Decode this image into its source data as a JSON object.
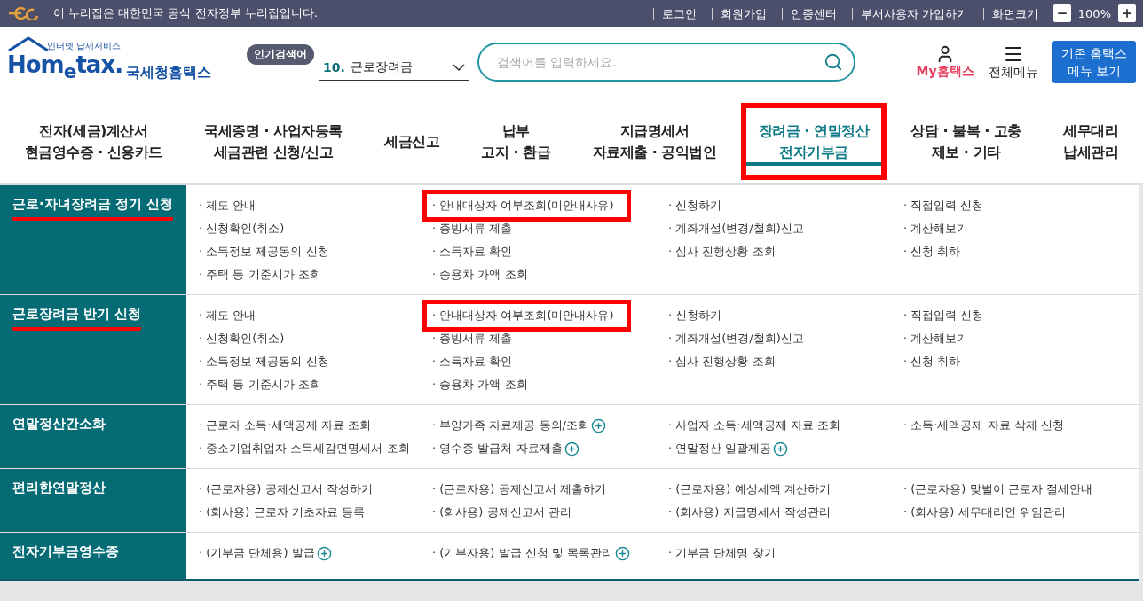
{
  "top_bar": {
    "notice": "이 누리집은 대한민국 공식 전자정부 누리집입니다.",
    "links": [
      "로그인",
      "회원가입",
      "인증센터",
      "부서사용자 가입하기"
    ],
    "zoom_label": "화면크기",
    "zoom_value": "100%"
  },
  "header": {
    "logo": {
      "tagline": "인터넷 납세서비스",
      "wordmark": "Hom$_{e}$tax.",
      "name": "국세청홈택스"
    },
    "popular": {
      "badge": "인기검색어",
      "rank": "10.",
      "term": "근로장려금"
    },
    "search": {
      "placeholder": "검색어를 입력하세요."
    },
    "my_label": "My홈택스",
    "menu_label": "전체메뉴",
    "legacy_button": "기존 홈택스\n메뉴 보기"
  },
  "nav_tabs": [
    {
      "label": "전자(세금)계산서\n현금영수증 · 신용카드",
      "selected": false,
      "boxed": false
    },
    {
      "label": "국세증명 · 사업자등록\n세금관련 신청/신고",
      "selected": false,
      "boxed": false
    },
    {
      "label": "세금신고",
      "selected": false,
      "boxed": false
    },
    {
      "label": "납부\n고지 · 환급",
      "selected": false,
      "boxed": false
    },
    {
      "label": "지급명세서\n자료제출 · 공익법인",
      "selected": false,
      "boxed": false
    },
    {
      "label": "장려금 · 연말정산\n전자기부금",
      "selected": true,
      "boxed": true
    },
    {
      "label": "상담 · 불복 · 고충\n제보 · 기타",
      "selected": false,
      "boxed": false
    },
    {
      "label": "세무대리\n납세관리",
      "selected": false,
      "boxed": false
    }
  ],
  "sections": [
    {
      "title": "근로·자녀장려금 정기 신청",
      "underlined": true,
      "columns": [
        [
          {
            "text": "· 제도 안내",
            "plus": false,
            "boxed": false
          },
          {
            "text": "· 신청확인(취소)",
            "plus": false,
            "boxed": false
          },
          {
            "text": "· 소득정보 제공동의 신청",
            "plus": false,
            "boxed": false
          },
          {
            "text": "· 주택 등 기준시가 조회",
            "plus": false,
            "boxed": false
          }
        ],
        [
          {
            "text": "· 안내대상자 여부조회(미안내사유)",
            "plus": false,
            "boxed": true
          },
          {
            "text": "· 증빙서류 제출",
            "plus": false,
            "boxed": false
          },
          {
            "text": "· 소득자료 확인",
            "plus": false,
            "boxed": false
          },
          {
            "text": "· 승용차 가액 조회",
            "plus": false,
            "boxed": false
          }
        ],
        [
          {
            "text": "· 신청하기",
            "plus": false,
            "boxed": false
          },
          {
            "text": "· 계좌개설(변경/철회)신고",
            "plus": false,
            "boxed": false
          },
          {
            "text": "· 심사 진행상황 조회",
            "plus": false,
            "boxed": false
          }
        ],
        [
          {
            "text": "· 직접입력 신청",
            "plus": false,
            "boxed": false
          },
          {
            "text": "· 계산해보기",
            "plus": false,
            "boxed": false
          },
          {
            "text": "· 신청 취하",
            "plus": false,
            "boxed": false
          }
        ]
      ]
    },
    {
      "title": "근로장려금 반기 신청",
      "underlined": true,
      "columns": [
        [
          {
            "text": "· 제도 안내",
            "plus": false,
            "boxed": false
          },
          {
            "text": "· 신청확인(취소)",
            "plus": false,
            "boxed": false
          },
          {
            "text": "· 소득정보 제공동의 신청",
            "plus": false,
            "boxed": false
          },
          {
            "text": "· 주택 등 기준시가 조회",
            "plus": false,
            "boxed": false
          }
        ],
        [
          {
            "text": "· 안내대상자 여부조회(미안내사유)",
            "plus": false,
            "boxed": true
          },
          {
            "text": "· 증빙서류 제출",
            "plus": false,
            "boxed": false
          },
          {
            "text": "· 소득자료 확인",
            "plus": false,
            "boxed": false
          },
          {
            "text": "· 승용차 가액 조회",
            "plus": false,
            "boxed": false
          }
        ],
        [
          {
            "text": "· 신청하기",
            "plus": false,
            "boxed": false
          },
          {
            "text": "· 계좌개설(변경/철회)신고",
            "plus": false,
            "boxed": false
          },
          {
            "text": "· 심사 진행상황 조회",
            "plus": false,
            "boxed": false
          }
        ],
        [
          {
            "text": "· 직접입력 신청",
            "plus": false,
            "boxed": false
          },
          {
            "text": "· 계산해보기",
            "plus": false,
            "boxed": false
          },
          {
            "text": "· 신청 취하",
            "plus": false,
            "boxed": false
          }
        ]
      ]
    },
    {
      "title": "연말정산간소화",
      "underlined": false,
      "columns": [
        [
          {
            "text": "· 근로자 소득·세액공제 자료 조회",
            "plus": false,
            "boxed": false
          },
          {
            "text": "· 중소기업취업자 소득세감면명세서 조회",
            "plus": false,
            "boxed": false
          }
        ],
        [
          {
            "text": "· 부양가족 자료제공 동의/조회",
            "plus": true,
            "boxed": false
          },
          {
            "text": "· 영수증 발급처 자료제출",
            "plus": true,
            "boxed": false
          }
        ],
        [
          {
            "text": "· 사업자 소득·세액공제 자료 조회",
            "plus": false,
            "boxed": false
          },
          {
            "text": "· 연말정산 일괄제공",
            "plus": true,
            "boxed": false
          }
        ],
        [
          {
            "text": "· 소득·세액공제 자료 삭제 신청",
            "plus": false,
            "boxed": false
          }
        ]
      ]
    },
    {
      "title": "편리한연말정산",
      "underlined": false,
      "columns": [
        [
          {
            "text": "· (근로자용) 공제신고서 작성하기",
            "plus": false,
            "boxed": false
          },
          {
            "text": "· (회사용) 근로자 기초자료 등록",
            "plus": false,
            "boxed": false
          }
        ],
        [
          {
            "text": "· (근로자용) 공제신고서 제출하기",
            "plus": false,
            "boxed": false
          },
          {
            "text": "· (회사용) 공제신고서 관리",
            "plus": false,
            "boxed": false
          }
        ],
        [
          {
            "text": "· (근로자용) 예상세액 계산하기",
            "plus": false,
            "boxed": false
          },
          {
            "text": "· (회사용) 지급명세서 작성관리",
            "plus": false,
            "boxed": false
          }
        ],
        [
          {
            "text": "· (근로자용) 맞벌이 근로자 절세안내",
            "plus": false,
            "boxed": false
          },
          {
            "text": "· (회사용) 세무대리인 위임관리",
            "plus": false,
            "boxed": false
          }
        ]
      ]
    },
    {
      "title": "전자기부금영수증",
      "underlined": false,
      "columns": [
        [
          {
            "text": "· (기부금 단체용) 발급",
            "plus": true,
            "boxed": false
          }
        ],
        [
          {
            "text": "· (기부자용) 발급 신청 및 목록관리",
            "plus": true,
            "boxed": false
          }
        ],
        [
          {
            "text": "· 기부금 단체명 찾기",
            "plus": false,
            "boxed": false
          }
        ]
      ]
    }
  ]
}
